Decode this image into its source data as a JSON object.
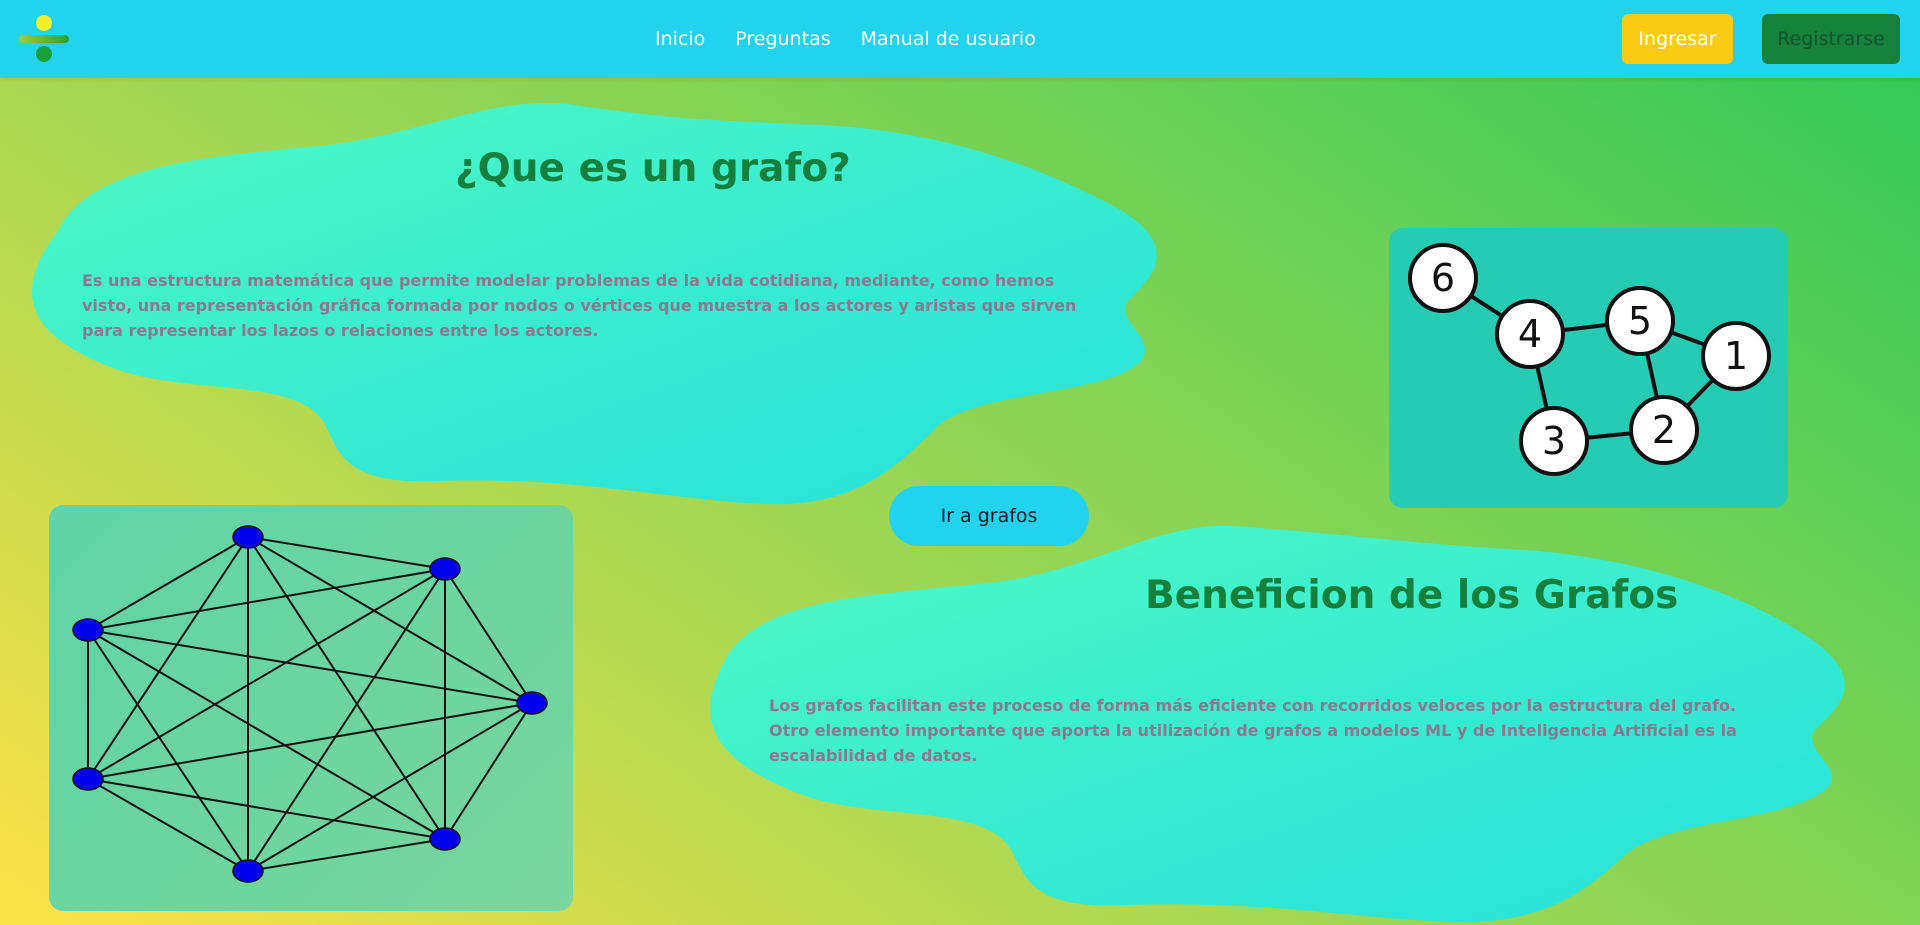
{
  "nav": {
    "links": [
      "Inicio",
      "Preguntas",
      "Manual de usuario"
    ],
    "login_label": "Ingresar",
    "register_label": "Registrarse"
  },
  "section1": {
    "title": "¿Que es un grafo?",
    "text": "Es una estructura matemática que permite modelar problemas de la vida cotidiana, mediante, como hemos visto, una representación gráfica formada por nodos o vértices que muestra a los actores y aristas que sirven para representar los lazos o relaciones entre los actores."
  },
  "go_button_label": "Ir a grafos",
  "section2": {
    "title": "Beneficion de los Grafos",
    "lines": [
      "Los grafos facilitan este proceso de forma más eficiente con recorridos veloces por la estructura del grafo.",
      "Otro elemento importante que aporta la utilización de grafos a modelos ML y de Inteligencia Artificial es la escalabilidad de datos."
    ]
  },
  "graph_numbered": {
    "node_labels": [
      "6",
      "4",
      "5",
      "1",
      "3",
      "2"
    ]
  },
  "colors": {
    "navbar": "#22d3ee",
    "heading": "#15803d",
    "paragraph": "#8b7a8f",
    "login_button": "#facc15",
    "register_button": "#16803d",
    "blob_start": "#4cf8c2",
    "blob_end": "#26e1dd",
    "complete_graph_node": "#0000ee"
  }
}
